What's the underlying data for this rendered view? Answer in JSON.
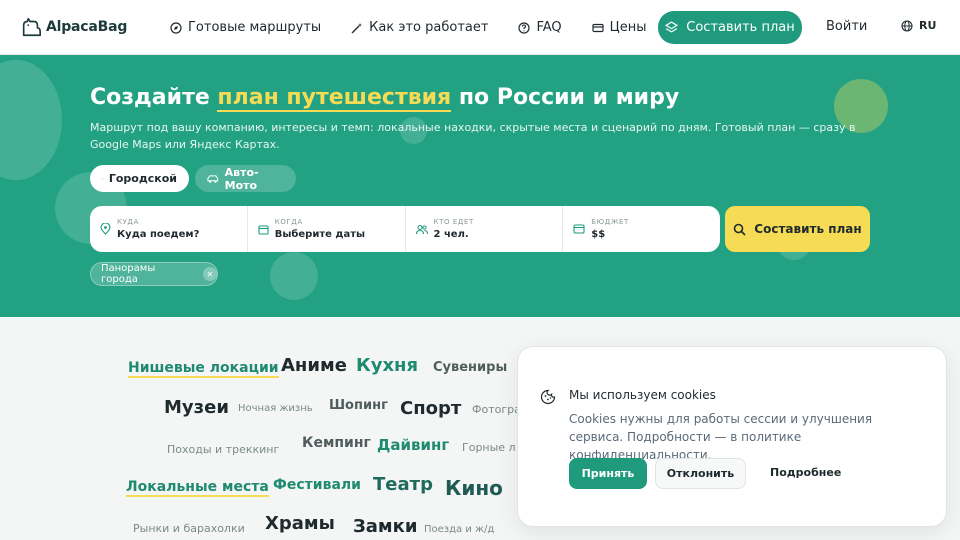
{
  "brand": {
    "name": "AlpacaBag"
  },
  "nav": [
    {
      "label": "Готовые маршруты",
      "icon": "compass-icon"
    },
    {
      "label": "Как это работает",
      "icon": "magic-wand-icon"
    },
    {
      "label": "FAQ",
      "icon": "question-icon"
    },
    {
      "label": "Цены",
      "icon": "card-icon"
    }
  ],
  "header": {
    "cta_label": "Составить план",
    "login_label": "Войти",
    "lang_label": "RU"
  },
  "hero": {
    "title_before": "Создайте ",
    "title_highlight": "план путешествия",
    "title_after": " по России и миру",
    "subtitle": "Маршрут под вашу компанию, интересы и темп: локальные находки, скрытые места и сценарий по дням. Готовый план — сразу в Google Maps или Яндекс Картах.",
    "modes": [
      {
        "label": "Городской",
        "active": true
      },
      {
        "label": "Авто-Мото",
        "active": false
      }
    ],
    "search": {
      "where_label": "КУДА",
      "where_value": "Куда поедем?",
      "when_label": "КОГДА",
      "when_value": "Выберите даты",
      "who_label": "КТО ЕДЕТ",
      "who_value": "2 чел.",
      "budget_label": "БЮДЖЕТ",
      "budget_value": "$$"
    },
    "submit_label": "Составить план",
    "chip_label": "Панорамы города"
  },
  "tags": {
    "t1": "Нишевые локации",
    "t2": "Аниме",
    "t3": "Кухня",
    "t4": "Сувениры",
    "t5": "Музеи",
    "t6": "Ночная жизнь",
    "t7": "Шопинг",
    "t8": "Спорт",
    "t9": "Фотогра",
    "t10": "Походы и треккинг",
    "t11": "Кемпинг",
    "t12": "Дайвинг",
    "t13": "Горные л",
    "t14": "Локальные места",
    "t15": "Фестивали",
    "t16": "Театр",
    "t17": "Кино",
    "t18": "Рынки и барахолки",
    "t19": "Храмы",
    "t20": "Замки",
    "t21": "Поезда и ж/д"
  },
  "cookie": {
    "title": "Мы используем cookies",
    "text": "Cookies нужны для работы сессии и улучшения сервиса. Подробности — в политике конфиденциальности.",
    "accept": "Принять",
    "decline": "Отклонить",
    "more": "Подробнее"
  },
  "colors": {
    "primary": "#1f9a7d",
    "hero_bg": "#23a283",
    "accent": "#f6dc55"
  }
}
